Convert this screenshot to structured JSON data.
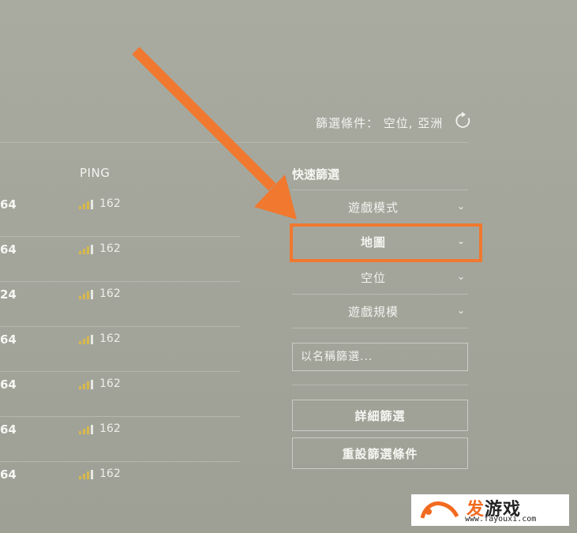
{
  "filter_status": {
    "text": "篩選條件： 空位, 亞洲"
  },
  "table": {
    "ping_header": "PING",
    "rows": [
      {
        "players": "64",
        "ping": "162"
      },
      {
        "players": "64",
        "ping": "162"
      },
      {
        "players": "24",
        "ping": "162"
      },
      {
        "players": "64",
        "ping": "162"
      },
      {
        "players": "64",
        "ping": "162"
      },
      {
        "players": "64",
        "ping": "162"
      },
      {
        "players": "64",
        "ping": "162"
      }
    ]
  },
  "sidebar": {
    "quick_filter_title": "快速篩選",
    "items": [
      {
        "label": "遊戲模式"
      },
      {
        "label": "地圖"
      },
      {
        "label": "空位"
      },
      {
        "label": "遊戲規模"
      }
    ],
    "name_filter_placeholder": "以名稱篩選...",
    "advanced_filter_label": "詳細篩選",
    "reset_filter_label": "重設篩選條件"
  },
  "colors": {
    "highlight": "#f0782f",
    "signal": "#d8b84a"
  },
  "watermark": {
    "brand_a": "发",
    "brand_b": "游戏",
    "url": "www.fayouxi.com"
  }
}
